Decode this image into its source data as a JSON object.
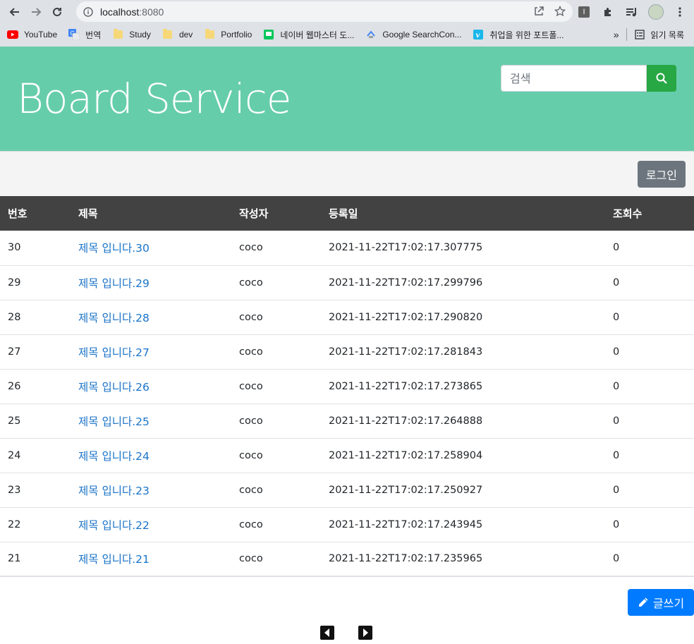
{
  "browser": {
    "url_host": "localhost",
    "url_port": ":8080",
    "bookmarks": [
      {
        "label": "YouTube",
        "icon": "youtube-icon"
      },
      {
        "label": "번역",
        "icon": "translate-icon"
      },
      {
        "label": "Study",
        "icon": "folder-icon"
      },
      {
        "label": "dev",
        "icon": "folder-icon"
      },
      {
        "label": "Portfolio",
        "icon": "folder-icon"
      },
      {
        "label": "네이버 웹마스터 도...",
        "icon": "naver-icon"
      },
      {
        "label": "Google SearchCon...",
        "icon": "google-search-console-icon"
      },
      {
        "label": "취업을 위한 포트폴...",
        "icon": "vimeo-icon"
      }
    ],
    "reading_list": "읽기 목록",
    "more": "»"
  },
  "header": {
    "title": "Board Service",
    "search_placeholder": "검색"
  },
  "actions": {
    "login_label": "로그인",
    "write_label": "글쓰기"
  },
  "table": {
    "columns": [
      "번호",
      "제목",
      "작성자",
      "등록일",
      "조회수"
    ],
    "rows": [
      {
        "no": "30",
        "title": "제목 입니다.30",
        "author": "coco",
        "date": "2021-11-22T17:02:17.307775",
        "views": "0"
      },
      {
        "no": "29",
        "title": "제목 입니다.29",
        "author": "coco",
        "date": "2021-11-22T17:02:17.299796",
        "views": "0"
      },
      {
        "no": "28",
        "title": "제목 입니다.28",
        "author": "coco",
        "date": "2021-11-22T17:02:17.290820",
        "views": "0"
      },
      {
        "no": "27",
        "title": "제목 입니다.27",
        "author": "coco",
        "date": "2021-11-22T17:02:17.281843",
        "views": "0"
      },
      {
        "no": "26",
        "title": "제목 입니다.26",
        "author": "coco",
        "date": "2021-11-22T17:02:17.273865",
        "views": "0"
      },
      {
        "no": "25",
        "title": "제목 입니다.25",
        "author": "coco",
        "date": "2021-11-22T17:02:17.264888",
        "views": "0"
      },
      {
        "no": "24",
        "title": "제목 입니다.24",
        "author": "coco",
        "date": "2021-11-22T17:02:17.258904",
        "views": "0"
      },
      {
        "no": "23",
        "title": "제목 입니다.23",
        "author": "coco",
        "date": "2021-11-22T17:02:17.250927",
        "views": "0"
      },
      {
        "no": "22",
        "title": "제목 입니다.22",
        "author": "coco",
        "date": "2021-11-22T17:02:17.243945",
        "views": "0"
      },
      {
        "no": "21",
        "title": "제목 입니다.21",
        "author": "coco",
        "date": "2021-11-22T17:02:17.235965",
        "views": "0"
      }
    ]
  },
  "colors": {
    "header_bg": "#66cdaa",
    "search_button": "#28a745",
    "login_button": "#6c757d",
    "write_button": "#007bff",
    "table_header": "#424242",
    "link": "#1a73c7"
  }
}
